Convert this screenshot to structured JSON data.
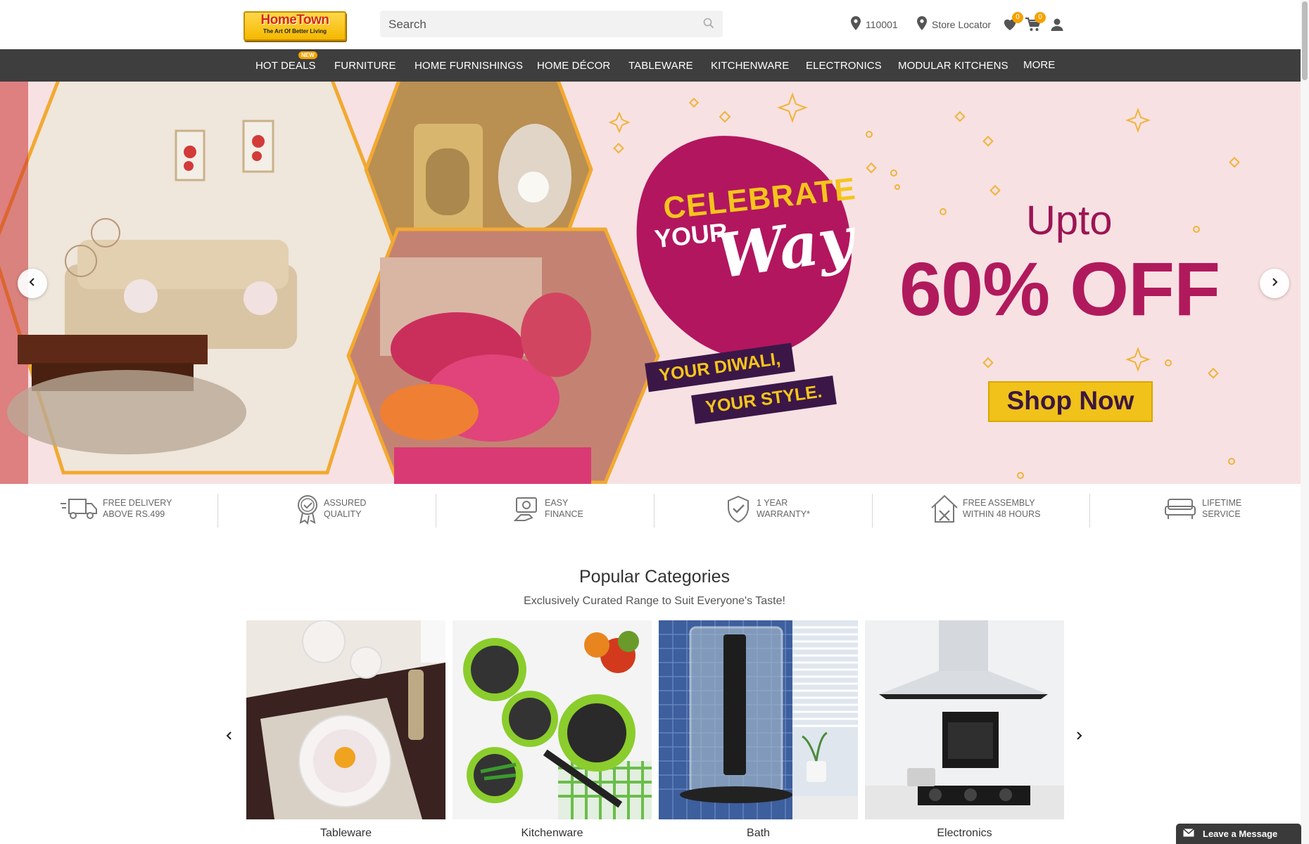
{
  "header": {
    "logo": {
      "title": "HomeTown",
      "tagline": "The Art Of Better Living"
    },
    "search": {
      "placeholder": "Search"
    },
    "pincode": "110001",
    "store_locator": "Store Locator",
    "wishlist_count": "0",
    "cart_count": "0"
  },
  "nav": {
    "new_badge": "NEW",
    "items": [
      "HOT DEALS",
      "FURNITURE",
      "HOME FURNISHINGS",
      "HOME DÉCOR",
      "TABLEWARE",
      "KITCHENWARE",
      "ELECTRONICS",
      "MODULAR KITCHENS",
      "MORE"
    ]
  },
  "banner": {
    "headline_1": "CELEBRATE",
    "headline_2": "YOUR",
    "headline_3": "Way",
    "ribbon_1": "YOUR DIWALI,",
    "ribbon_2": "YOUR STYLE.",
    "upto": "Upto",
    "discount": "60% OFF",
    "cta": "Shop Now"
  },
  "features": [
    {
      "icon": "truck-icon",
      "line1": "FREE DELIVERY",
      "line2": "ABOVE RS.499"
    },
    {
      "icon": "award-icon",
      "line1": "ASSURED",
      "line2": "QUALITY"
    },
    {
      "icon": "finance-icon",
      "line1": "EASY",
      "line2": "FINANCE"
    },
    {
      "icon": "shield-check-icon",
      "line1": "1 YEAR",
      "line2": "WARRANTY*"
    },
    {
      "icon": "tools-house-icon",
      "line1": "FREE ASSEMBLY",
      "line2": "WITHIN 48 HOURS"
    },
    {
      "icon": "sofa-icon",
      "line1": "LIFETIME",
      "line2": "SERVICE"
    }
  ],
  "popular": {
    "title": "Popular Categories",
    "subtitle": "Exclusively Curated Range to Suit Everyone's Taste!",
    "categories": [
      "Tableware",
      "Kitchenware",
      "Bath",
      "Electronics"
    ]
  },
  "chat": {
    "label": "Leave a Message"
  },
  "colors": {
    "accent": "#f5a200",
    "nav_bg": "#3e3e3e",
    "banner_bg": "#f8e1e3",
    "promo": "#b01a5c",
    "cta": "#f0c21a"
  }
}
